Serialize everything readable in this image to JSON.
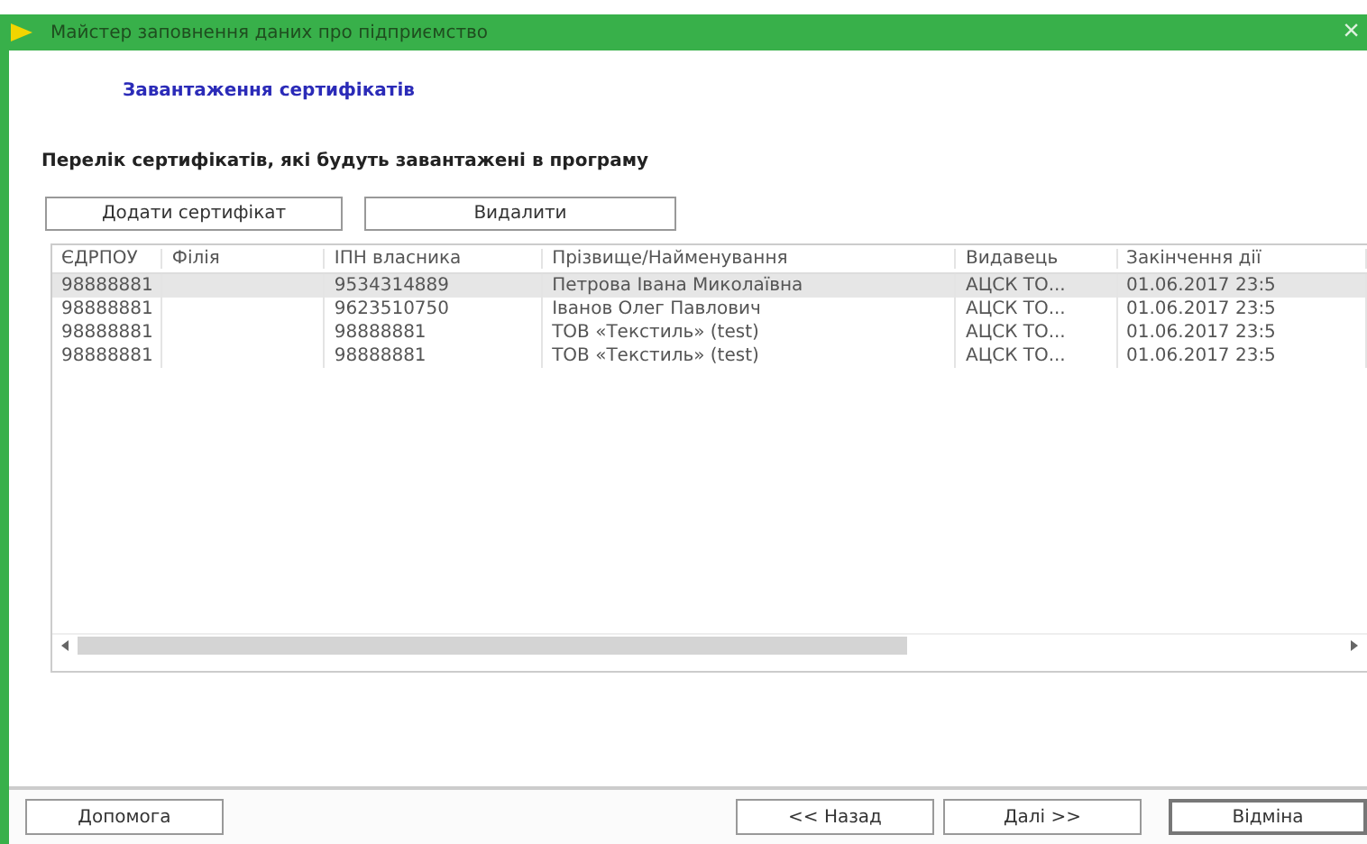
{
  "window": {
    "title": "Майстер заповнення даних про підприємство",
    "close": "×"
  },
  "subtitle": "Завантаження сертифікатів",
  "heading": "Перелік сертифікатів, які будуть завантажені в програму",
  "toolbar": [
    "Додати сертифікат",
    "Видалити"
  ],
  "table": {
    "columns": [
      "ЄДРПОУ",
      "Філія",
      "ІПН власника",
      "Прізвище/Найменування",
      "Видавець",
      "Закінчення дії"
    ],
    "rows": [
      {
        "selected": true,
        "cells": [
          "98888881",
          "",
          "9534314889",
          "Петрова Івана Миколаївна",
          "АЦСК ТО...",
          "01.06.2017 23:5"
        ]
      },
      {
        "selected": false,
        "cells": [
          "98888881",
          "",
          "9623510750",
          "Іванов Олег Павлович",
          "АЦСК ТО...",
          "01.06.2017 23:5"
        ]
      },
      {
        "selected": false,
        "cells": [
          "98888881",
          "",
          "98888881",
          "ТОВ «Текстиль» (test)",
          "АЦСК ТО...",
          "01.06.2017 23:5"
        ]
      },
      {
        "selected": false,
        "cells": [
          "98888881",
          "",
          "98888881",
          "ТОВ «Текстиль» (test)",
          "АЦСК ТО...",
          "01.06.2017 23:5"
        ]
      }
    ]
  },
  "footer": {
    "help": "Допомога",
    "buttons": [
      {
        "label": "<< Назад",
        "kind": "normal"
      },
      {
        "label": "Далі >>",
        "kind": "normal"
      },
      {
        "label": "Відміна",
        "kind": "default"
      }
    ]
  }
}
